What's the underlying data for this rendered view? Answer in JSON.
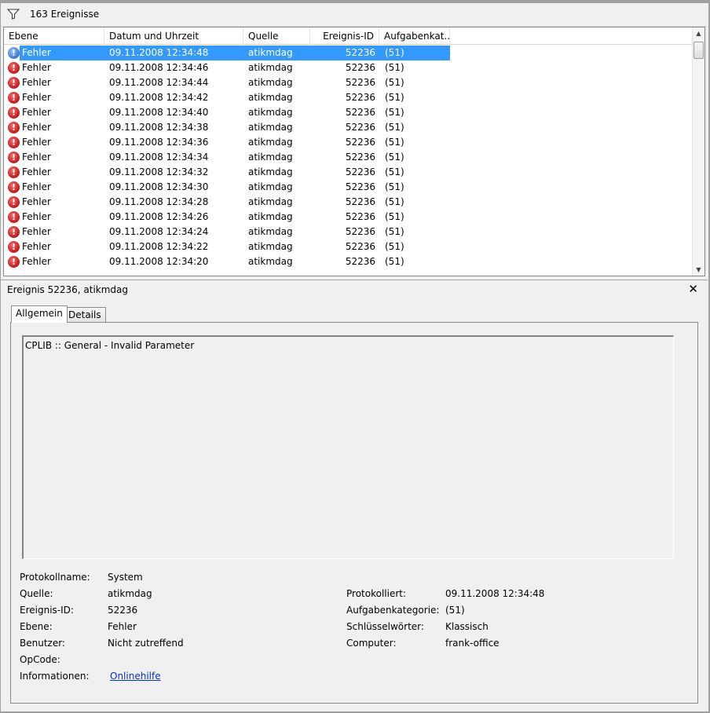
{
  "toolbar": {
    "event_count": "163 Ereignisse"
  },
  "list": {
    "columns": [
      "Ebene",
      "Datum und Uhrzeit",
      "Quelle",
      "Ereignis-ID",
      "Aufgabenkat..."
    ],
    "rows": [
      {
        "level": "Fehler",
        "datetime": "09.11.2008 12:34:48",
        "source": "atikmdag",
        "id": "52236",
        "task": "(51)"
      },
      {
        "level": "Fehler",
        "datetime": "09.11.2008 12:34:46",
        "source": "atikmdag",
        "id": "52236",
        "task": "(51)"
      },
      {
        "level": "Fehler",
        "datetime": "09.11.2008 12:34:44",
        "source": "atikmdag",
        "id": "52236",
        "task": "(51)"
      },
      {
        "level": "Fehler",
        "datetime": "09.11.2008 12:34:42",
        "source": "atikmdag",
        "id": "52236",
        "task": "(51)"
      },
      {
        "level": "Fehler",
        "datetime": "09.11.2008 12:34:40",
        "source": "atikmdag",
        "id": "52236",
        "task": "(51)"
      },
      {
        "level": "Fehler",
        "datetime": "09.11.2008 12:34:38",
        "source": "atikmdag",
        "id": "52236",
        "task": "(51)"
      },
      {
        "level": "Fehler",
        "datetime": "09.11.2008 12:34:36",
        "source": "atikmdag",
        "id": "52236",
        "task": "(51)"
      },
      {
        "level": "Fehler",
        "datetime": "09.11.2008 12:34:34",
        "source": "atikmdag",
        "id": "52236",
        "task": "(51)"
      },
      {
        "level": "Fehler",
        "datetime": "09.11.2008 12:34:32",
        "source": "atikmdag",
        "id": "52236",
        "task": "(51)"
      },
      {
        "level": "Fehler",
        "datetime": "09.11.2008 12:34:30",
        "source": "atikmdag",
        "id": "52236",
        "task": "(51)"
      },
      {
        "level": "Fehler",
        "datetime": "09.11.2008 12:34:28",
        "source": "atikmdag",
        "id": "52236",
        "task": "(51)"
      },
      {
        "level": "Fehler",
        "datetime": "09.11.2008 12:34:26",
        "source": "atikmdag",
        "id": "52236",
        "task": "(51)"
      },
      {
        "level": "Fehler",
        "datetime": "09.11.2008 12:34:24",
        "source": "atikmdag",
        "id": "52236",
        "task": "(51)"
      },
      {
        "level": "Fehler",
        "datetime": "09.11.2008 12:34:22",
        "source": "atikmdag",
        "id": "52236",
        "task": "(51)"
      },
      {
        "level": "Fehler",
        "datetime": "09.11.2008 12:34:20",
        "source": "atikmdag",
        "id": "52236",
        "task": "(51)"
      }
    ],
    "selected_index": 0
  },
  "detail": {
    "title": "Ereignis 52236, atikmdag",
    "close_glyph": "✕",
    "tabs": [
      "Allgemein",
      "Details"
    ],
    "message": "CPLIB :: General - Invalid Parameter",
    "fields_left": [
      {
        "label": "Protokollname:",
        "value": "System"
      },
      {
        "label": "Quelle:",
        "value": "atikmdag"
      },
      {
        "label": "Ereignis-ID:",
        "value": "52236"
      },
      {
        "label": "Ebene:",
        "value": "Fehler"
      },
      {
        "label": "Benutzer:",
        "value": "Nicht zutreffend"
      },
      {
        "label": "OpCode:",
        "value": ""
      },
      {
        "label": "Informationen:",
        "value": "Onlinehilfe"
      }
    ],
    "fields_right": [
      {
        "label": "Protokolliert:",
        "value": "09.11.2008 12:34:48"
      },
      {
        "label": "Aufgabenkategorie:",
        "value": "(51)"
      },
      {
        "label": "Schlüsselwörter:",
        "value": "Klassisch"
      },
      {
        "label": "Computer:",
        "value": "frank-office"
      }
    ]
  },
  "colors": {
    "selection": "#3399ff",
    "error": "#c41818",
    "link": "#0033cc"
  }
}
